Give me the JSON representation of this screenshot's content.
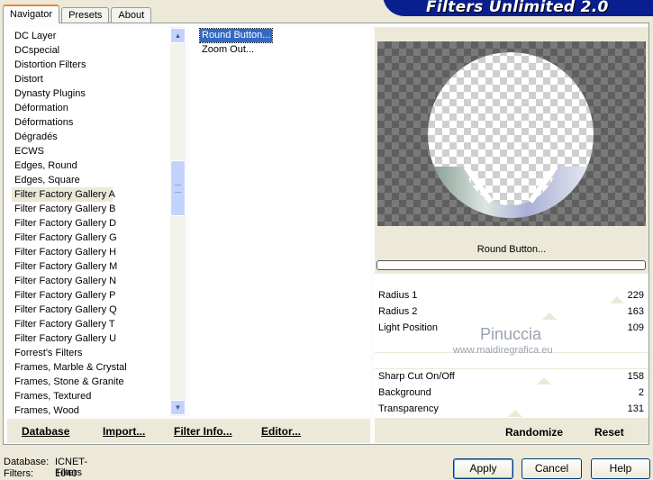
{
  "tabs": [
    "Navigator",
    "Presets",
    "About"
  ],
  "banner": "Filters Unlimited 2.0",
  "categories": [
    "DC Layer",
    "DCspecial",
    "Distortion Filters",
    "Distort",
    "Dynasty Plugins",
    "Déformation",
    "Déformations",
    "Dégradés",
    "ECWS",
    "Edges, Round",
    "Edges, Square",
    "Filter Factory Gallery A",
    "Filter Factory Gallery B",
    "Filter Factory Gallery D",
    "Filter Factory Gallery G",
    "Filter Factory Gallery H",
    "Filter Factory Gallery M",
    "Filter Factory Gallery N",
    "Filter Factory Gallery P",
    "Filter Factory Gallery Q",
    "Filter Factory Gallery T",
    "Filter Factory Gallery U",
    "Forrest's Filters",
    "Frames, Marble & Crystal",
    "Frames, Stone & Granite",
    "Frames, Textured",
    "Frames, Wood"
  ],
  "selected_category": "Filter Factory Gallery A",
  "filters": [
    "Round Button...",
    "Zoom Out..."
  ],
  "selected_filter": "Round Button...",
  "bottom_buttons": {
    "database": "Database",
    "import": "Import...",
    "filter_info": "Filter Info...",
    "editor": "Editor..."
  },
  "filter_name": "Round Button...",
  "sliders": [
    {
      "label": "Radius 1",
      "value": "229",
      "level": 0.9
    },
    {
      "label": "Radius 2",
      "value": "163",
      "level": 0.64
    },
    {
      "label": "Light Position",
      "value": "109"
    },
    {
      "label": "Sharp Cut On/Off",
      "value": "158",
      "level": 0.62
    },
    {
      "label": "Background",
      "value": "2"
    },
    {
      "label": "Transparency",
      "value": "131",
      "level": 0.51
    }
  ],
  "randomize": "Randomize",
  "reset": "Reset",
  "status": {
    "database_label": "Database:",
    "database_value": "ICNET-Filters",
    "filters_label": "Filters:",
    "filters_value": "1040"
  },
  "buttons": {
    "apply": "Apply",
    "cancel": "Cancel",
    "help": "Help"
  },
  "watermark": {
    "line1": "Pinuccia",
    "line2": "www.maidiregrafica.eu"
  },
  "colors": {
    "selection": "#316ac5",
    "banner": "#0a1f8f",
    "panel": "#ece9d8"
  }
}
